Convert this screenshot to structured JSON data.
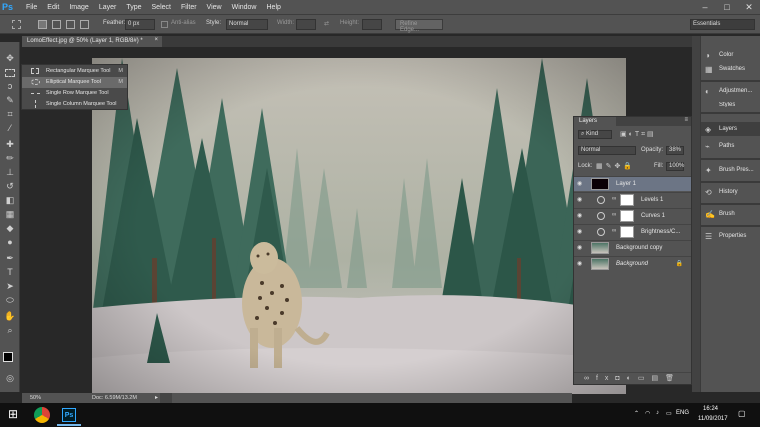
{
  "app": {
    "logo": "Ps"
  },
  "menu": [
    "File",
    "Edit",
    "Image",
    "Layer",
    "Type",
    "Select",
    "Filter",
    "View",
    "Window",
    "Help"
  ],
  "window_controls": {
    "minimize": "–",
    "maximize": "□",
    "close": "✕"
  },
  "options": {
    "feather_label": "Feather:",
    "feather_value": "0 px",
    "antialias_label": "Anti-alias",
    "style_label": "Style:",
    "style_value": "Normal",
    "width_label": "Width:",
    "height_label": "Height:",
    "refine_label": "Refine Edge...",
    "workspace": "Essentials"
  },
  "document": {
    "tab_label": "LomoEffect.jpg @ 50% (Layer 1, RGB/8#) *",
    "close": "×",
    "zoom": "50%",
    "doc_info": "Doc: 6.59M/13.2M"
  },
  "marquee_popup": [
    {
      "label": "Rectangular Marquee Tool",
      "shortcut": "M",
      "selected": false
    },
    {
      "label": "Elliptical Marquee Tool",
      "shortcut": "M",
      "selected": true
    },
    {
      "label": "Single Row Marquee Tool",
      "shortcut": "",
      "selected": false
    },
    {
      "label": "Single Column Marquee Tool",
      "shortcut": "",
      "selected": false
    }
  ],
  "layers_panel": {
    "tab": "Layers",
    "filter_kind": "Kind",
    "blend_mode": "Normal",
    "opacity_label": "Opacity:",
    "opacity_value": "38%",
    "lock_label": "Lock:",
    "fill_label": "Fill:",
    "fill_value": "100%",
    "layers": [
      {
        "name": "Layer 1",
        "selected": true
      },
      {
        "name": "Levels 1",
        "selected": false
      },
      {
        "name": "Curves 1",
        "selected": false
      },
      {
        "name": "Brightness/C...",
        "selected": false
      },
      {
        "name": "Background copy",
        "selected": false
      },
      {
        "name": "Background",
        "selected": false
      }
    ]
  },
  "right_panels": [
    "Color",
    "Swatches",
    "Adjustmen...",
    "Styles",
    "Layers",
    "Paths",
    "Brush Pres...",
    "History",
    "Brush",
    "Properties"
  ],
  "taskbar": {
    "lang": "ENG",
    "time": "16:24",
    "date": "11/09/2017"
  },
  "colors": {
    "ui_bg": "#535353",
    "canvas_bg": "#282828",
    "selected_layer": "#6c7585",
    "ps_blue": "#31a8ff"
  }
}
